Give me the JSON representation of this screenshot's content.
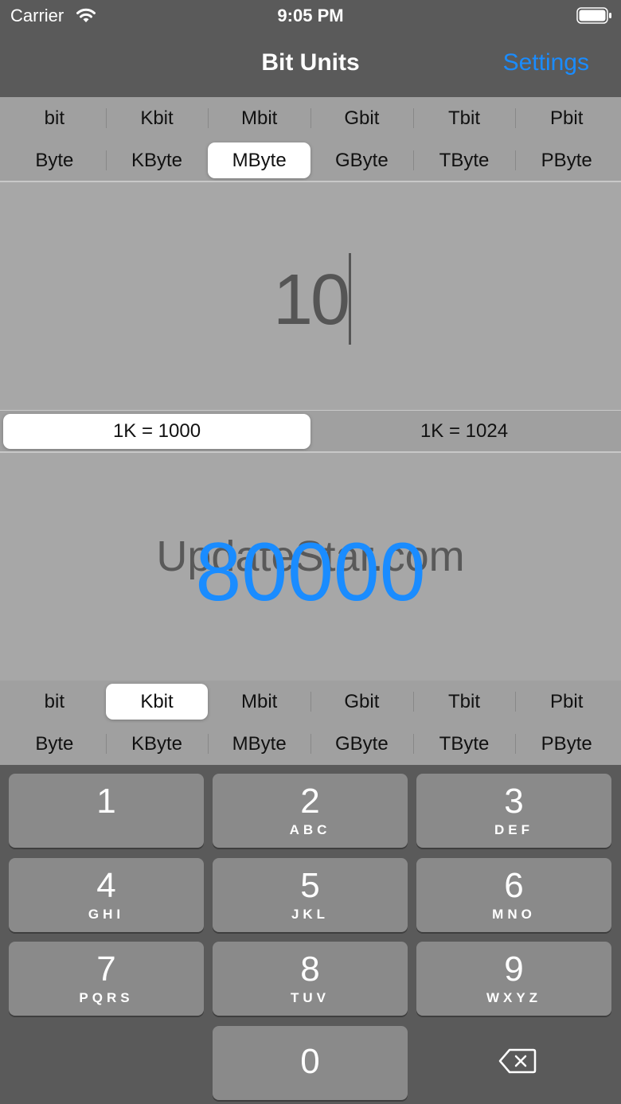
{
  "status": {
    "carrier": "Carrier",
    "time": "9:05 PM"
  },
  "nav": {
    "title": "Bit Units",
    "settings": "Settings"
  },
  "input_units": {
    "bits": [
      "bit",
      "Kbit",
      "Mbit",
      "Gbit",
      "Tbit",
      "Pbit"
    ],
    "bytes": [
      "Byte",
      "KByte",
      "MByte",
      "GByte",
      "TByte",
      "PByte"
    ],
    "selected": "MByte"
  },
  "input_value": "10",
  "mode": {
    "options": [
      "1K = 1000",
      "1K = 1024"
    ],
    "selected": "1K = 1000"
  },
  "output": {
    "value": "80000",
    "watermark": "UpdateStar.com"
  },
  "output_units": {
    "bits": [
      "bit",
      "Kbit",
      "Mbit",
      "Gbit",
      "Tbit",
      "Pbit"
    ],
    "bytes": [
      "Byte",
      "KByte",
      "MByte",
      "GByte",
      "TByte",
      "PByte"
    ],
    "selected": "Kbit"
  },
  "keypad": {
    "keys": [
      {
        "num": "1",
        "letters": ""
      },
      {
        "num": "2",
        "letters": "ABC"
      },
      {
        "num": "3",
        "letters": "DEF"
      },
      {
        "num": "4",
        "letters": "GHI"
      },
      {
        "num": "5",
        "letters": "JKL"
      },
      {
        "num": "6",
        "letters": "MNO"
      },
      {
        "num": "7",
        "letters": "PQRS"
      },
      {
        "num": "8",
        "letters": "TUV"
      },
      {
        "num": "9",
        "letters": "WXYZ"
      },
      {
        "num": "0",
        "letters": ""
      }
    ]
  },
  "colors": {
    "accent": "#1a8cff",
    "background": "#5a5a5a",
    "panel": "#a7a7a7"
  }
}
